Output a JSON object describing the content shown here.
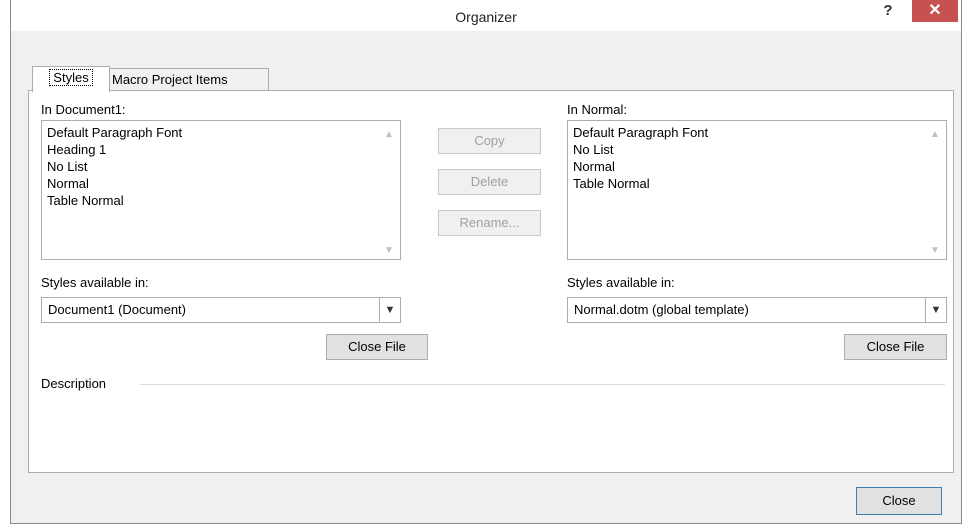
{
  "window": {
    "title": "Organizer",
    "help": "?",
    "close": "✕"
  },
  "tabs": [
    {
      "label": "Styles"
    },
    {
      "label": "Macro Project Items"
    }
  ],
  "left": {
    "label": "In Document1:",
    "items": [
      "Default Paragraph Font",
      "Heading 1",
      "No List",
      "Normal",
      "Table Normal"
    ],
    "available_label": "Styles available in:",
    "available_value": "Document1 (Document)",
    "close_file": "Close File"
  },
  "right": {
    "label": "In Normal:",
    "items": [
      "Default Paragraph Font",
      "No List",
      "Normal",
      "Table Normal"
    ],
    "available_label": "Styles available in:",
    "available_value": "Normal.dotm (global template)",
    "close_file": "Close File"
  },
  "actions": {
    "copy": "Copy",
    "delete": "Delete",
    "rename": "Rename..."
  },
  "description": {
    "label": "Description"
  },
  "footer": {
    "close": "Close"
  }
}
